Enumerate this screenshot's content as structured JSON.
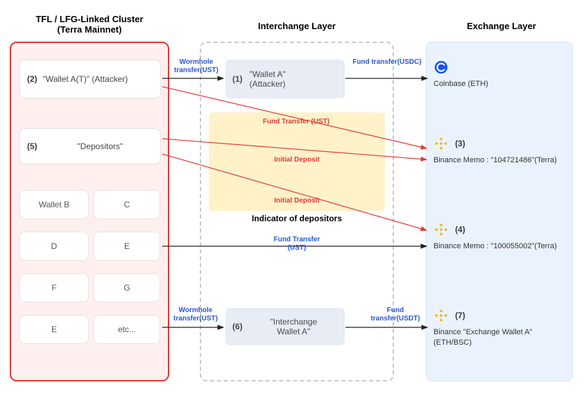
{
  "headers": {
    "left_line1": "TFL / LFG-Linked Cluster",
    "left_line2": "(Terra Mainnet)",
    "mid": "Interchange Layer",
    "right": "Exchange Layer"
  },
  "left": {
    "box1_num": "(2)",
    "box1_label": "\"Wallet A(T)\" (Attacker)",
    "box2_num": "(5)",
    "box2_label": "\"Depositors\"",
    "b": "Wallet B",
    "c": "C",
    "d": "D",
    "e": "E",
    "f": "F",
    "g": "G",
    "e2": "E",
    "etc": "etc..."
  },
  "mid": {
    "card1_num": "(1)",
    "card1_l1": "\"Wallet A\"",
    "card1_l2": "(Attacker)",
    "indicator": "Indicator of depositors",
    "card2_num": "(6)",
    "card2_l1": "\"Interchange",
    "card2_l2": "Wallet A\""
  },
  "right": {
    "r1_num": "",
    "r1_label": "Coinbase (ETH)",
    "r3_num": "(3)",
    "r3_label": "Binance Memo : \"104721486\"(Terra)",
    "r4_num": "(4)",
    "r4_label": "Binance Memo : \"100055002\"(Terra)",
    "r7_num": "(7)",
    "r7_label": "Binance \"Exchange Wallet A\" (ETH/BSC)"
  },
  "arrows": {
    "a1": "Wormhole transfer(UST)",
    "a2": "Fund transfer(USDC)",
    "a3": "Fund Transfer (UST)",
    "a4": "Initial Deposit",
    "a5": "Initial Deposit",
    "a6": "Fund Transfer (UST)",
    "a7": "Wormhole transfer(UST)",
    "a8": "Fund transfer(USDT)"
  },
  "icons": {
    "coinbase_color": "#1652f0",
    "binance_color": "#f0b90b"
  }
}
